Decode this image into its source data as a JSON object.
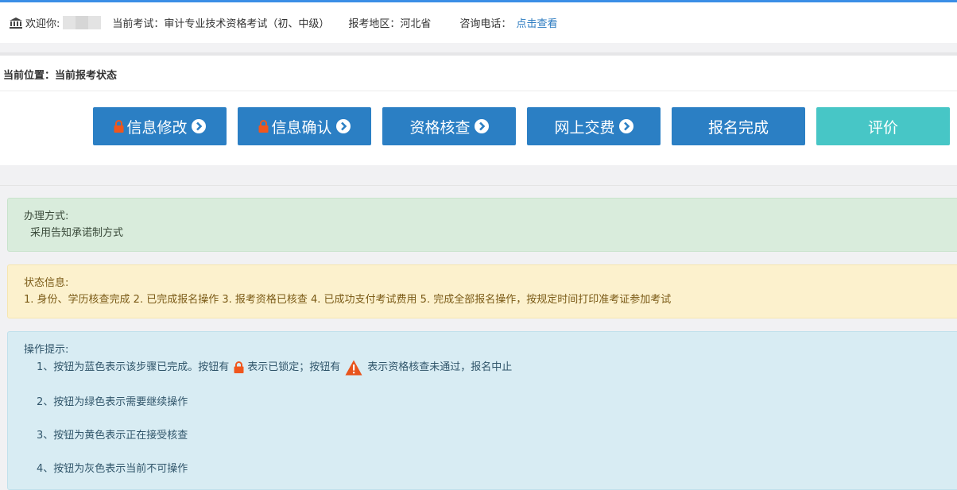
{
  "header": {
    "welcome_label": "欢迎你:",
    "exam_label": "当前考试：审计专业技术资格考试（初、中级）",
    "area_label": "报考地区：河北省",
    "phone_label": "咨询电话：",
    "phone_link": "点击查看"
  },
  "breadcrumb": "当前位置：当前报考状态",
  "steps": [
    {
      "label": "信息修改",
      "locked": true,
      "arrow": true
    },
    {
      "label": "信息确认",
      "locked": true,
      "arrow": true
    },
    {
      "label": "资格核查",
      "locked": false,
      "arrow": true
    },
    {
      "label": "网上交费",
      "locked": false,
      "arrow": true
    },
    {
      "label": "报名完成",
      "locked": false,
      "arrow": false
    },
    {
      "label": "评价",
      "locked": false,
      "arrow": false
    }
  ],
  "method": {
    "title": "办理方式:",
    "content": "采用告知承诺制方式"
  },
  "status": {
    "title": "状态信息:",
    "content": "1. 身份、学历核查完成 2. 已完成报名操作 3. 报考资格已核查 4. 已成功支付考试费用 5. 完成全部报名操作，按规定时间打印准考证参加考试"
  },
  "tips": {
    "title": "操作提示:",
    "line1_a": "1、按钮为蓝色表示该步骤已完成。按钮有",
    "line1_b": "表示已锁定；按钮有",
    "line1_c": "表示资格核查未通过，报名中止",
    "line2": "2、按钮为绿色表示需要继续操作",
    "line3": "3、按钮为黄色表示正在接受核查",
    "line4": "4、按钮为灰色表示当前不可操作"
  },
  "colors": {
    "completed_blue": "#2b7fc4",
    "evaluate_teal": "#47c6c6",
    "lock_orange": "#f0561d",
    "warning_orange": "#e8541c"
  }
}
